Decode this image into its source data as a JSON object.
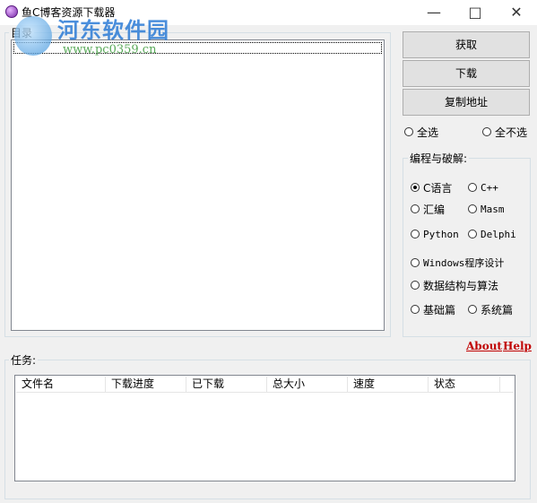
{
  "window": {
    "title": "鱼C博客资源下载器"
  },
  "watermark": {
    "text": "河东软件园",
    "url": "www.pc0359.cn"
  },
  "catalog": {
    "label": "目录"
  },
  "buttons": {
    "fetch": "获取",
    "download": "下载",
    "copy_address": "复制地址"
  },
  "select": {
    "all": "全选",
    "none": "全不选"
  },
  "programming": {
    "label": "编程与破解:",
    "options": [
      "C语言",
      "C++",
      "汇编",
      "Masm",
      "Python",
      "Delphi",
      "Windows程序设计",
      "数据结构与算法",
      "基础篇",
      "系统篇"
    ],
    "selected": "C语言"
  },
  "links": {
    "about": "About",
    "help": "Help"
  },
  "tasks": {
    "label": "任务:",
    "columns": [
      "文件名",
      "下载进度",
      "已下载",
      "总大小",
      "速度",
      "状态"
    ],
    "rows": []
  },
  "icons": {
    "app": "fishc-app-icon",
    "minimize": "minimize-icon",
    "maximize": "maximize-icon",
    "close": "close-icon"
  }
}
